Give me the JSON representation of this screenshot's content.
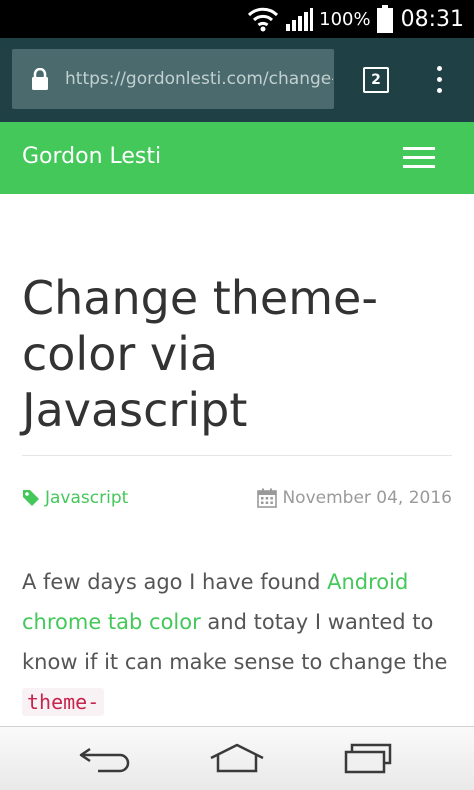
{
  "status_bar": {
    "icons": [
      "wifi-icon",
      "signal-icon",
      "battery-icon"
    ],
    "battery_percent": "100%",
    "time": "08:31"
  },
  "browser": {
    "url": "https://gordonlesti.com/change-theme-color-via-javascript",
    "tab_count": "2",
    "icons": [
      "lock-icon",
      "overflow-menu-icon"
    ]
  },
  "site": {
    "title": "Gordon Lesti",
    "menu_icon": "hamburger-icon",
    "brand_color": "#44c85a"
  },
  "article": {
    "title": "Change theme-color via Javascript",
    "tag": "Javascript",
    "date": "November 04, 2016",
    "body": {
      "text_1": "A few days ago I have found ",
      "link_text": "Android chrome tab color",
      "text_2": " and totay I wanted to know if it can make sense to change the ",
      "code": "theme-"
    }
  },
  "nav_bar": {
    "buttons": [
      "back-icon",
      "home-icon",
      "recent-apps-icon"
    ]
  },
  "colors": {
    "browser_toolbar": "#1f4044",
    "url_box": "#4b6a6d",
    "header": "#44c85a",
    "link": "#44c85a",
    "code_text": "#c7254e"
  }
}
